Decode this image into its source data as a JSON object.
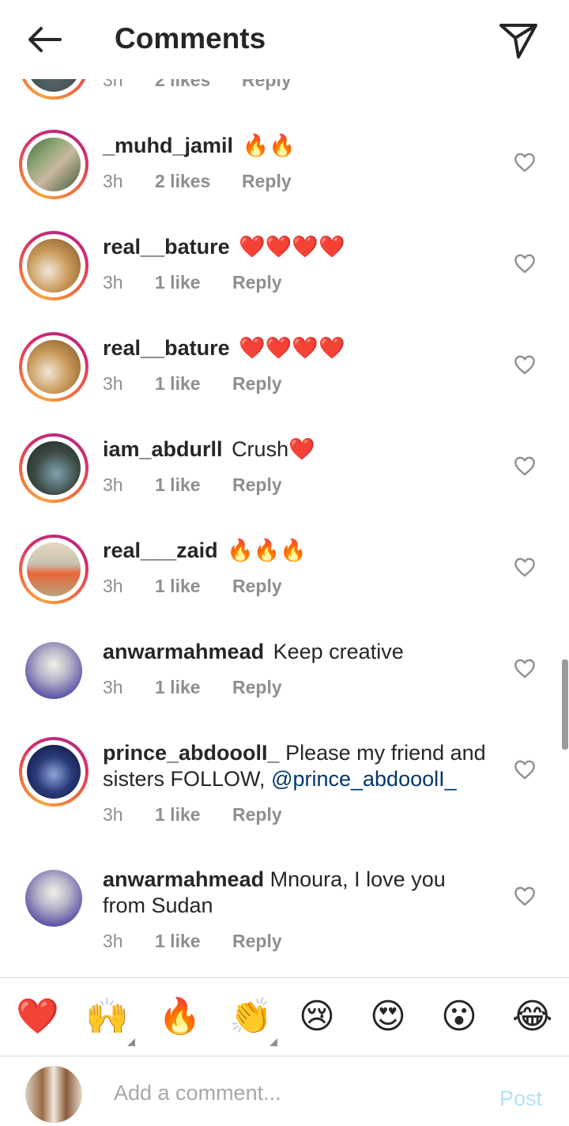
{
  "header": {
    "title": "Comments",
    "back_icon": "arrow-left-icon",
    "share_icon": "paper-plane-icon"
  },
  "partial_row": {
    "time": "3h",
    "likes": "2 likes",
    "reply": "Reply"
  },
  "comments": [
    {
      "username": "_muhd_jamil",
      "text": "🔥🔥",
      "time": "3h",
      "likes": "2 likes",
      "reply": "Reply",
      "story_ring": true
    },
    {
      "username": "real__bature",
      "text": "❤️❤️❤️❤️",
      "time": "3h",
      "likes": "1 like",
      "reply": "Reply",
      "story_ring": true
    },
    {
      "username": "real__bature",
      "text": "❤️❤️❤️❤️",
      "time": "3h",
      "likes": "1 like",
      "reply": "Reply",
      "story_ring": true
    },
    {
      "username": "iam_abdurll",
      "text": "Crush❤️",
      "time": "3h",
      "likes": "1 like",
      "reply": "Reply",
      "story_ring": true
    },
    {
      "username": "real___zaid",
      "text": "🔥🔥🔥",
      "time": "3h",
      "likes": "1 like",
      "reply": "Reply",
      "story_ring": true
    },
    {
      "username": "anwarmahmead",
      "text": "Keep creative",
      "time": "3h",
      "likes": "1 like",
      "reply": "Reply",
      "story_ring": false
    },
    {
      "username": "prince_abdooolI_",
      "text": "Please my friend and sisters FOLLOW,",
      "mention": "@prince_abdooolI_",
      "time": "3h",
      "likes": "1 like",
      "reply": "Reply",
      "story_ring": true
    },
    {
      "username": "anwarmahmead",
      "text": "Mnoura, I love you from Sudan",
      "time": "3h",
      "likes": "1 like",
      "reply": "Reply",
      "story_ring": false
    }
  ],
  "emoji_bar": [
    "❤️",
    "🙌",
    "🔥",
    "👏",
    "😢",
    "😍",
    "😮",
    "😂"
  ],
  "composer": {
    "placeholder": "Add a comment...",
    "post_label": "Post"
  },
  "colors": {
    "text": "#262626",
    "secondary": "#8e8e8e",
    "mention": "#00376b",
    "post_disabled": "#b2dffc"
  }
}
